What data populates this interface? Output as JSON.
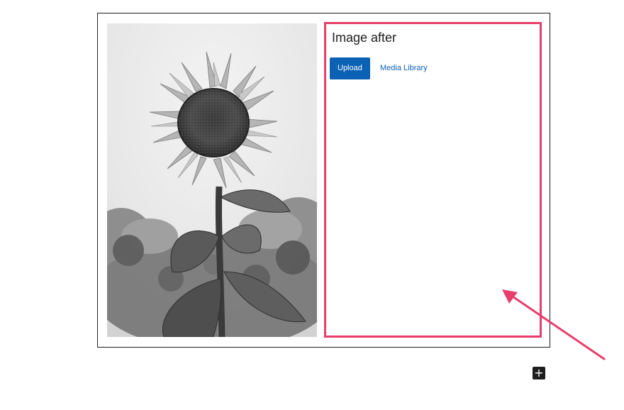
{
  "placeholder": {
    "title": "Image after",
    "upload_label": "Upload",
    "media_library_label": "Media Library"
  },
  "before_image": {
    "subject": "black-and-white sunflower photo"
  },
  "add_block": {
    "icon": "plus-icon",
    "label": "+"
  },
  "colors": {
    "frame_border": "#1e1e1e",
    "highlight": "#e83e6c",
    "accent": "#0b62b5",
    "add_button": "#1e1e1e"
  }
}
